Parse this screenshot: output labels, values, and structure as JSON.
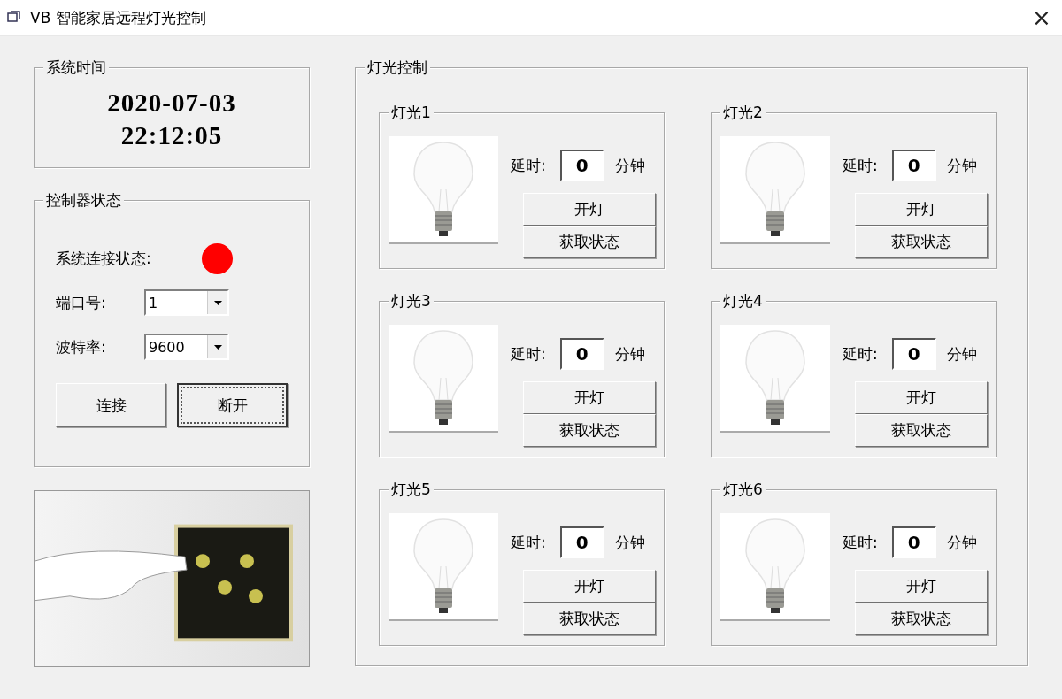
{
  "window": {
    "title": "VB 智能家居远程灯光控制",
    "close": "×"
  },
  "time_group": {
    "title": "系统时间",
    "date": "2020-07-03",
    "time": "22:12:05"
  },
  "controller": {
    "title": "控制器状态",
    "status_label": "系统连接状态:",
    "connected": false,
    "port_label": "端口号:",
    "port_value": "1",
    "baud_label": "波特率:",
    "baud_value": "9600",
    "buttons": [
      {
        "label": "连接",
        "focused": false
      },
      {
        "label": "断开",
        "focused": true
      }
    ]
  },
  "light_group": {
    "title": "灯光控制",
    "lamps": [
      {
        "title": "灯光1",
        "delay_label": "延时:",
        "delay": "0",
        "unit": "分钟",
        "on_button": "开灯",
        "status_button": "获取状态"
      },
      {
        "title": "灯光2",
        "delay_label": "延时:",
        "delay": "0",
        "unit": "分钟",
        "on_button": "开灯",
        "status_button": "获取状态"
      },
      {
        "title": "灯光3",
        "delay_label": "延时:",
        "delay": "0",
        "unit": "分钟",
        "on_button": "开灯",
        "status_button": "获取状态"
      },
      {
        "title": "灯光4",
        "delay_label": "延时:",
        "delay": "0",
        "unit": "分钟",
        "on_button": "开灯",
        "status_button": "获取状态"
      },
      {
        "title": "灯光5",
        "delay_label": "延时:",
        "delay": "0",
        "unit": "分钟",
        "on_button": "开灯",
        "status_button": "获取状态"
      },
      {
        "title": "灯光6",
        "delay_label": "延时:",
        "delay": "0",
        "unit": "分钟",
        "on_button": "开灯",
        "status_button": "获取状态"
      }
    ]
  }
}
